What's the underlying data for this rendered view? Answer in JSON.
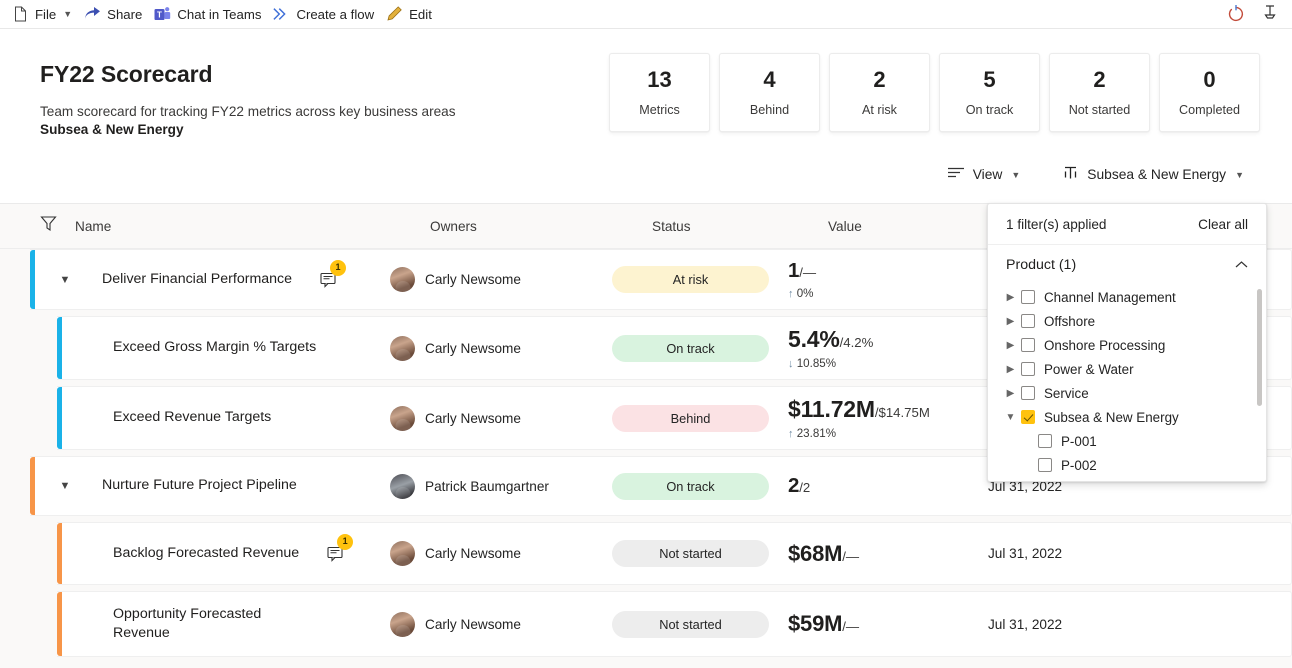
{
  "commandbar": {
    "items": [
      {
        "label": "File",
        "icon": "file-icon",
        "has_chevron": true
      },
      {
        "label": "Share",
        "icon": "share-icon",
        "has_chevron": false
      },
      {
        "label": "Chat in Teams",
        "icon": "teams-icon",
        "has_chevron": false
      },
      {
        "label": "Create a flow",
        "icon": "flow-icon",
        "has_chevron": false
      },
      {
        "label": "Edit",
        "icon": "pencil-icon",
        "has_chevron": false
      }
    ],
    "right_icons": [
      "refresh-icon",
      "pin-icon"
    ]
  },
  "header": {
    "title": "FY22 Scorecard",
    "subtitle": "Team scorecard for tracking FY22 metrics across key business areas",
    "subtitle2": "Subsea & New Energy"
  },
  "stats": [
    {
      "value": "13",
      "label": "Metrics"
    },
    {
      "value": "4",
      "label": "Behind"
    },
    {
      "value": "2",
      "label": "At risk"
    },
    {
      "value": "5",
      "label": "On track"
    },
    {
      "value": "2",
      "label": "Not started"
    },
    {
      "value": "0",
      "label": "Completed"
    }
  ],
  "toolbar": {
    "view_label": "View",
    "filter_label": "Subsea & New Energy"
  },
  "table": {
    "columns": {
      "name": "Name",
      "owners": "Owners",
      "status": "Status",
      "value": "Value"
    },
    "rows": [
      {
        "name": "Deliver Financial Performance",
        "level": 0,
        "accent": "#1ab2e8",
        "expanded": true,
        "note_count": "1",
        "owner": "Carly Newsome",
        "status": "At risk",
        "status_class": "atrisk",
        "value_main": "1",
        "value_target": "/—",
        "delta_arrow": "↑",
        "delta": "0%",
        "date": ""
      },
      {
        "name": "Exceed Gross Margin % Targets",
        "level": 1,
        "accent": "#1ab2e8",
        "expanded": false,
        "note_count": "",
        "owner": "Carly Newsome",
        "status": "On track",
        "status_class": "ontrack",
        "value_main": "5.4%",
        "value_target": "/4.2%",
        "delta_arrow": "↓",
        "delta": "10.85%",
        "date": ""
      },
      {
        "name": "Exceed Revenue Targets",
        "level": 1,
        "accent": "#1ab2e8",
        "expanded": false,
        "note_count": "",
        "owner": "Carly Newsome",
        "status": "Behind",
        "status_class": "behind",
        "value_main": "$11.72M",
        "value_target": "/$14.75M",
        "delta_arrow": "↑",
        "delta": "23.81%",
        "date": ""
      },
      {
        "name": "Nurture Future Project Pipeline",
        "level": 0,
        "accent": "#f79548",
        "expanded": true,
        "note_count": "",
        "owner": "Patrick Baumgartner",
        "status": "On track",
        "status_class": "ontrack",
        "value_main": "2",
        "value_target": "/2",
        "delta_arrow": "",
        "delta": "",
        "date": "Jul 31, 2022"
      },
      {
        "name": "Backlog Forecasted Revenue",
        "level": 1,
        "accent": "#f79548",
        "expanded": false,
        "note_count": "1",
        "owner": "Carly Newsome",
        "status": "Not started",
        "status_class": "notstarted",
        "value_main": "$68M",
        "value_target": "/—",
        "delta_arrow": "",
        "delta": "",
        "date": "Jul 31, 2022"
      },
      {
        "name": "Opportunity Forecasted Revenue",
        "level": 1,
        "accent": "#f79548",
        "expanded": false,
        "note_count": "",
        "owner": "Carly Newsome",
        "status": "Not started",
        "status_class": "notstarted",
        "value_main": "$59M",
        "value_target": "/—",
        "delta_arrow": "",
        "delta": "",
        "date": "Jul 31, 2022"
      }
    ]
  },
  "filter_flyout": {
    "applied_text": "1 filter(s) applied",
    "clear_all": "Clear all",
    "group_label": "Product (1)",
    "items": [
      {
        "label": "Channel Management",
        "checked": false,
        "expandable": true,
        "child": false,
        "expanded": false
      },
      {
        "label": "Offshore",
        "checked": false,
        "expandable": true,
        "child": false,
        "expanded": false
      },
      {
        "label": "Onshore Processing",
        "checked": false,
        "expandable": true,
        "child": false,
        "expanded": false
      },
      {
        "label": "Power & Water",
        "checked": false,
        "expandable": true,
        "child": false,
        "expanded": false
      },
      {
        "label": "Service",
        "checked": false,
        "expandable": true,
        "child": false,
        "expanded": false
      },
      {
        "label": "Subsea & New Energy",
        "checked": true,
        "expandable": true,
        "child": false,
        "expanded": true
      },
      {
        "label": "P-001",
        "checked": false,
        "expandable": false,
        "child": true,
        "expanded": false
      },
      {
        "label": "P-002",
        "checked": false,
        "expandable": false,
        "child": true,
        "expanded": false
      }
    ]
  },
  "colors": {
    "accent_blue": "#1ab2e8",
    "accent_orange": "#f79548",
    "badge_yellow": "#ffc20e",
    "at_risk": "#fdf3d0",
    "on_track": "#d9f3df",
    "behind": "#fbe2e4",
    "not_started": "#ededed"
  }
}
